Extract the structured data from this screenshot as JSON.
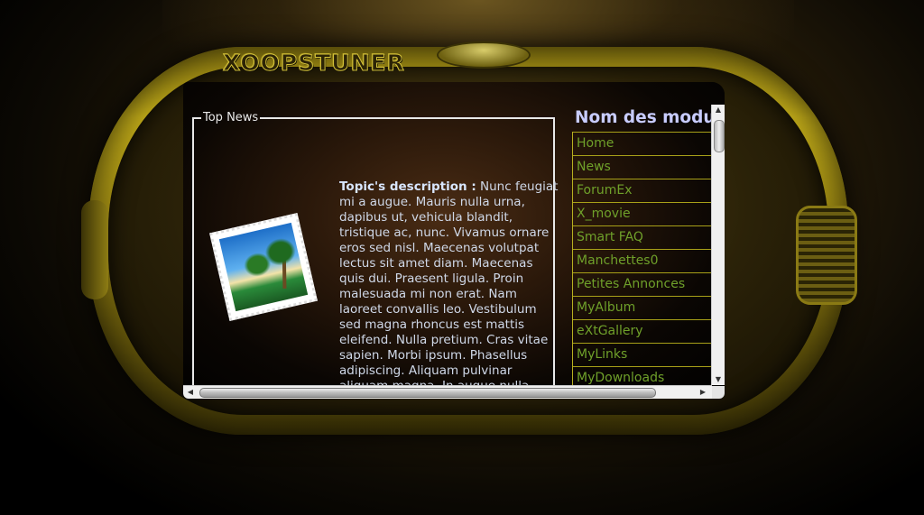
{
  "site": {
    "logo_text": "XOOPSTUNER"
  },
  "news_block": {
    "legend": "Top News",
    "image_icon": "stamp-photo-icon",
    "topic_label": "Topic's description :",
    "topic_body": " Nunc feugiat mi a augue. Mauris nulla urna, dapibus ut, vehicula blandit, tristique ac, nunc. Vivamus ornare eros sed nisl. Maecenas volutpat lectus sit amet diam. Maecenas quis dui. Praesent ligula. Proin malesuada mi non erat. Nam laoreet convallis leo. Vestibulum sed magna rhoncus est mattis eleifend. Nulla pretium. Cras vitae sapien. Morbi ipsum. Phasellus adipiscing. Aliquam pulvinar aliquam magna. In augue nulla, ullamcorper ac, sagittis vel, condimentum"
  },
  "modules": {
    "title": "Nom des modul",
    "items": [
      {
        "label": "Home"
      },
      {
        "label": "News"
      },
      {
        "label": "ForumEx"
      },
      {
        "label": "X_movie"
      },
      {
        "label": "Smart FAQ"
      },
      {
        "label": "Manchettes0"
      },
      {
        "label": "Petites Annonces"
      },
      {
        "label": "MyAlbum"
      },
      {
        "label": "eXtGallery"
      },
      {
        "label": "MyLinks"
      },
      {
        "label": "MyDownloads"
      }
    ]
  },
  "scrollbars": {
    "up_arrow": "▲",
    "down_arrow": "▼",
    "left_arrow": "◀",
    "right_arrow": "▶"
  },
  "colors": {
    "frame_gold": "#c9b21a",
    "module_link": "#6fa02a",
    "module_title": "#c8ccff",
    "text": "#cfd8e8"
  }
}
